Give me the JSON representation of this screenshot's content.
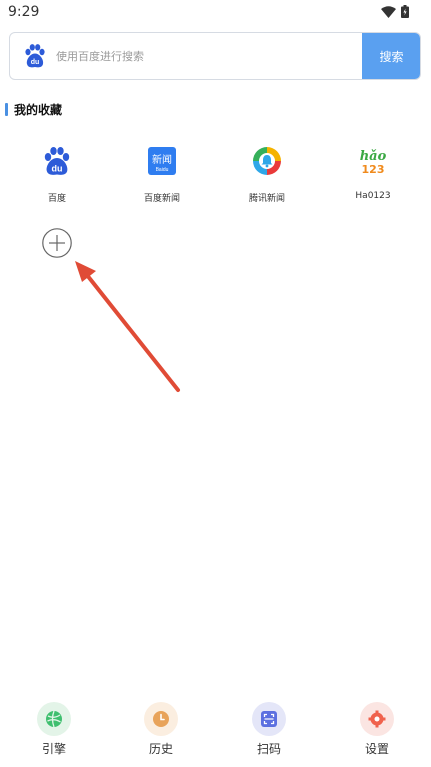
{
  "status_bar": {
    "time": "9:29"
  },
  "search": {
    "placeholder": "使用百度进行搜索",
    "button_label": "搜索"
  },
  "favorites_section": {
    "title": "我的收藏",
    "items": [
      {
        "label": "百度",
        "icon": "baidu-logo-icon"
      },
      {
        "label": "百度新闻",
        "icon": "baidu-news-icon",
        "icon_text": "新闻",
        "icon_subtext": "Baidu"
      },
      {
        "label": "腾讯新闻",
        "icon": "tencent-news-icon"
      },
      {
        "label": "Ha0123",
        "icon": "hao123-icon",
        "icon_line1": "hǎo",
        "icon_line2": "123"
      }
    ],
    "add_icon": "plus-circle-icon"
  },
  "bottom_nav": {
    "items": [
      {
        "label": "引擎",
        "icon": "engine-icon",
        "bg": "#e3f4e8",
        "fg": "#3fbf6f"
      },
      {
        "label": "历史",
        "icon": "history-clock-icon",
        "bg": "#fbeee0",
        "fg": "#e8a35a"
      },
      {
        "label": "扫码",
        "icon": "scan-icon",
        "bg": "#e4e6f8",
        "fg": "#5b6fe0"
      },
      {
        "label": "设置",
        "icon": "settings-gear-icon",
        "bg": "#fbe5e2",
        "fg": "#f0624d"
      }
    ]
  },
  "colors": {
    "accent": "#4a90e2",
    "search_button": "#5aa0f0",
    "annotation_arrow": "#e04b36"
  }
}
